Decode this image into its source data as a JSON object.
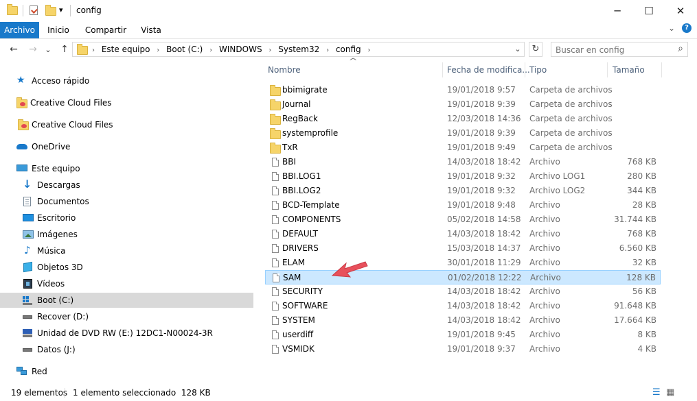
{
  "window": {
    "title": "config",
    "qa_dropdown": "▾",
    "minimize": "─",
    "maximize": "☐",
    "close": "✕",
    "ribbon_collapse": "⌄",
    "help": "?"
  },
  "ribbon": {
    "tabs": [
      "Archivo",
      "Inicio",
      "Compartir",
      "Vista"
    ]
  },
  "nav_buttons": {
    "back": "←",
    "forward": "→",
    "recent": "⌄",
    "up": "↑",
    "addr_dropdown": "⌄",
    "refresh": "↻"
  },
  "address": {
    "sep": "›",
    "crumbs": [
      "Este equipo",
      "Boot (C:)",
      "WINDOWS",
      "System32",
      "config"
    ]
  },
  "search": {
    "placeholder": "Buscar en config",
    "icon": "⌕"
  },
  "sidebar": {
    "items": [
      {
        "label": "Acceso rápido",
        "icon": "star-icon"
      },
      {
        "label": "Creative Cloud Files",
        "icon": "creative-cloud-folder-icon"
      },
      {
        "label": "Creative Cloud Files",
        "icon": "creative-cloud-folder-icon"
      },
      {
        "label": "OneDrive",
        "icon": "cloud-icon"
      },
      {
        "label": "Este equipo",
        "icon": "computer-icon"
      },
      {
        "label": "Descargas",
        "icon": "download-icon"
      },
      {
        "label": "Documentos",
        "icon": "document-icon"
      },
      {
        "label": "Escritorio",
        "icon": "desktop-icon"
      },
      {
        "label": "Imágenes",
        "icon": "image-icon"
      },
      {
        "label": "Música",
        "icon": "music-icon"
      },
      {
        "label": "Objetos 3D",
        "icon": "cube-icon"
      },
      {
        "label": "Vídeos",
        "icon": "video-icon"
      },
      {
        "label": "Boot (C:)",
        "icon": "drive-windows-icon"
      },
      {
        "label": "Recover (D:)",
        "icon": "drive-icon"
      },
      {
        "label": "Unidad de DVD RW (E:) 12DC1-N00024-3R",
        "icon": "dvd-icon"
      },
      {
        "label": "Datos (J:)",
        "icon": "drive-icon"
      },
      {
        "label": "Red",
        "icon": "network-icon"
      }
    ]
  },
  "columns": {
    "name": "Nombre",
    "date": "Fecha de modifica...",
    "type": "Tipo",
    "size": "Tamaño",
    "sort_indicator": "^"
  },
  "files": [
    {
      "name": "bbimigrate",
      "date": "19/01/2018 9:57",
      "type": "Carpeta de archivos",
      "size": "",
      "kind": "folder"
    },
    {
      "name": "Journal",
      "date": "19/01/2018 9:39",
      "type": "Carpeta de archivos",
      "size": "",
      "kind": "folder"
    },
    {
      "name": "RegBack",
      "date": "12/03/2018 14:36",
      "type": "Carpeta de archivos",
      "size": "",
      "kind": "folder"
    },
    {
      "name": "systemprofile",
      "date": "19/01/2018 9:39",
      "type": "Carpeta de archivos",
      "size": "",
      "kind": "folder"
    },
    {
      "name": "TxR",
      "date": "19/01/2018 9:49",
      "type": "Carpeta de archivos",
      "size": "",
      "kind": "folder"
    },
    {
      "name": "BBI",
      "date": "14/03/2018 18:42",
      "type": "Archivo",
      "size": "768 KB",
      "kind": "file"
    },
    {
      "name": "BBI.LOG1",
      "date": "19/01/2018 9:32",
      "type": "Archivo LOG1",
      "size": "280 KB",
      "kind": "file"
    },
    {
      "name": "BBI.LOG2",
      "date": "19/01/2018 9:32",
      "type": "Archivo LOG2",
      "size": "344 KB",
      "kind": "file"
    },
    {
      "name": "BCD-Template",
      "date": "19/01/2018 9:48",
      "type": "Archivo",
      "size": "28 KB",
      "kind": "file"
    },
    {
      "name": "COMPONENTS",
      "date": "05/02/2018 14:58",
      "type": "Archivo",
      "size": "31.744 KB",
      "kind": "file"
    },
    {
      "name": "DEFAULT",
      "date": "14/03/2018 18:42",
      "type": "Archivo",
      "size": "768 KB",
      "kind": "file"
    },
    {
      "name": "DRIVERS",
      "date": "15/03/2018 14:37",
      "type": "Archivo",
      "size": "6.560 KB",
      "kind": "file"
    },
    {
      "name": "ELAM",
      "date": "30/01/2018 11:29",
      "type": "Archivo",
      "size": "32 KB",
      "kind": "file"
    },
    {
      "name": "SAM",
      "date": "01/02/2018 12:22",
      "type": "Archivo",
      "size": "128 KB",
      "kind": "file",
      "selected": true
    },
    {
      "name": "SECURITY",
      "date": "14/03/2018 18:42",
      "type": "Archivo",
      "size": "56 KB",
      "kind": "file"
    },
    {
      "name": "SOFTWARE",
      "date": "14/03/2018 18:42",
      "type": "Archivo",
      "size": "91.648 KB",
      "kind": "file"
    },
    {
      "name": "SYSTEM",
      "date": "14/03/2018 18:42",
      "type": "Archivo",
      "size": "17.664 KB",
      "kind": "file"
    },
    {
      "name": "userdiff",
      "date": "19/01/2018 9:45",
      "type": "Archivo",
      "size": "8 KB",
      "kind": "file"
    },
    {
      "name": "VSMIDK",
      "date": "19/01/2018 9:37",
      "type": "Archivo",
      "size": "4 KB",
      "kind": "file"
    }
  ],
  "status": {
    "count": "19 elementos",
    "selection": "1 elemento seleccionado  128 KB",
    "details_view": "☰",
    "tiles_view": "▦"
  },
  "colors": {
    "accent": "#1979ca",
    "selection_bg": "#cce8ff",
    "selection_border": "#99d1ff",
    "arrow": "#e8505b"
  }
}
